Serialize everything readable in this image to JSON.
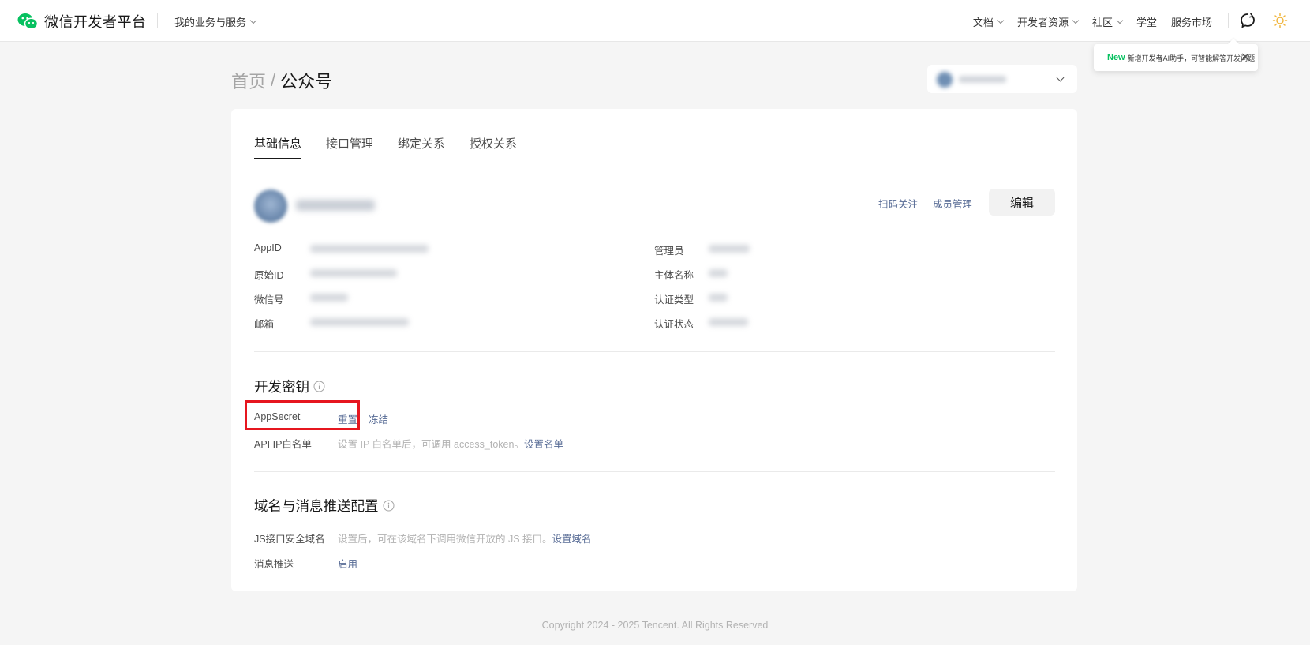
{
  "header": {
    "logo_text": "微信开发者平台",
    "biz_menu": "我的业务与服务",
    "nav": [
      "文档",
      "开发者资源",
      "社区",
      "学堂",
      "服务市场"
    ],
    "nav_has_chevron": [
      true,
      true,
      true,
      false,
      false
    ]
  },
  "tooltip": {
    "badge": "New",
    "text": "新增开发者AI助手，可智能解答开发问题"
  },
  "breadcrumb": {
    "home": "首页",
    "separator": "/",
    "current": "公众号"
  },
  "tabs": [
    {
      "label": "基础信息",
      "active": true
    },
    {
      "label": "接口管理",
      "active": false
    },
    {
      "label": "绑定关系",
      "active": false
    },
    {
      "label": "授权关系",
      "active": false
    }
  ],
  "profile": {
    "scan_follow": "扫码关注",
    "member_manage": "成员管理",
    "edit": "编辑"
  },
  "info": {
    "left": [
      "AppID",
      "原始ID",
      "微信号",
      "邮箱"
    ],
    "right": [
      "管理员",
      "主体名称",
      "认证类型",
      "认证状态"
    ]
  },
  "dev_key": {
    "title": "开发密钥",
    "appsecret_label": "AppSecret",
    "reset": "重置",
    "freeze": "冻结",
    "ip_label": "API IP白名单",
    "ip_hint": "设置 IP 白名单后，可调用 access_token。",
    "ip_link": "设置名单"
  },
  "domain": {
    "title": "域名与消息推送配置",
    "js_label": "JS接口安全域名",
    "js_hint": "设置后，可在该域名下调用微信开放的 JS 接口。",
    "js_link": "设置域名",
    "push_label": "消息推送",
    "push_link": "启用"
  },
  "footer": {
    "copyright": "Copyright 2024 - 2025 Tencent. All Rights Reserved"
  },
  "colors": {
    "brand_green": "#07c160",
    "link_blue": "#576b95",
    "highlight_red": "#e6161f"
  }
}
